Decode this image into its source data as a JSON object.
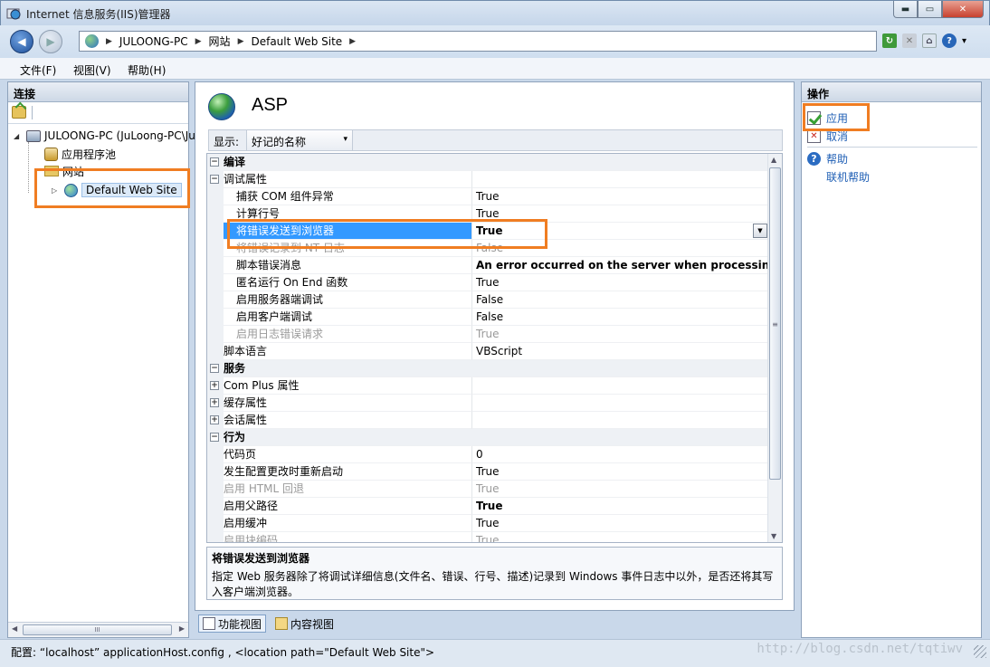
{
  "window": {
    "title": "Internet 信息服务(IIS)管理器",
    "buttons": {
      "minimize": "▬",
      "maximize": "▭",
      "close": "✕"
    }
  },
  "address_bar": {
    "segments": [
      "JULOONG-PC",
      "网站",
      "Default Web Site"
    ],
    "separator": "▶"
  },
  "nav": {
    "back": "◀",
    "forward": "▶"
  },
  "tool_icons": {
    "refresh": "↻",
    "stop": "✕",
    "home": "⌂",
    "help": "?",
    "help_arrow": "▾"
  },
  "menu": [
    "文件(F)",
    "视图(V)",
    "帮助(H)"
  ],
  "connections": {
    "header": "连接",
    "tree": {
      "server": "JULOONG-PC (JuLoong-PC\\JuLoong)",
      "app_pools": "应用程序池",
      "sites": "网站",
      "site": "Default Web Site"
    },
    "scroll_grip": "III"
  },
  "feature": {
    "title": "ASP",
    "display_label": "显示:",
    "display_value": "好记的名称",
    "dropdown_arrow": "▾"
  },
  "properties": {
    "rows": [
      {
        "type": "cat",
        "name": "编译",
        "value": "",
        "sign": "⊟"
      },
      {
        "type": "group",
        "name": "调试属性",
        "value": "",
        "sign": "⊟"
      },
      {
        "type": "sub",
        "name": "捕获 COM 组件异常",
        "value": "True"
      },
      {
        "type": "sub",
        "name": "计算行号",
        "value": "True"
      },
      {
        "type": "sub",
        "name": "将错误发送到浏览器",
        "value": "True",
        "selected": true,
        "bold": true
      },
      {
        "type": "sub",
        "name": "将错误记录到 NT 日志",
        "value": "False",
        "disabled": true
      },
      {
        "type": "sub",
        "name": "脚本错误消息",
        "value": "An error occurred on the server when processing the URL. Please contact the system administrator.",
        "bold": true
      },
      {
        "type": "sub",
        "name": "匿名运行 On End 函数",
        "value": "True"
      },
      {
        "type": "sub",
        "name": "启用服务器端调试",
        "value": "False"
      },
      {
        "type": "sub",
        "name": "启用客户端调试",
        "value": "False"
      },
      {
        "type": "sub",
        "name": "启用日志错误请求",
        "value": "True",
        "disabled": true
      },
      {
        "type": "plain",
        "name": "脚本语言",
        "value": "VBScript"
      },
      {
        "type": "cat",
        "name": "服务",
        "value": "",
        "sign": "⊟"
      },
      {
        "type": "group",
        "name": "Com Plus 属性",
        "value": "",
        "sign": "⊞"
      },
      {
        "type": "group",
        "name": "缓存属性",
        "value": "",
        "sign": "⊞"
      },
      {
        "type": "group",
        "name": "会话属性",
        "value": "",
        "sign": "⊞"
      },
      {
        "type": "cat",
        "name": "行为",
        "value": "",
        "sign": "⊟"
      },
      {
        "type": "plain",
        "name": "代码页",
        "value": "0"
      },
      {
        "type": "plain",
        "name": "发生配置更改时重新启动",
        "value": "True"
      },
      {
        "type": "plain",
        "name": "启用 HTML 回退",
        "value": "True",
        "disabled": true
      },
      {
        "type": "plain",
        "name": "启用父路径",
        "value": "True",
        "bold": true
      },
      {
        "type": "plain",
        "name": "启用缓冲",
        "value": "True"
      },
      {
        "type": "plain",
        "name": "启用块编码",
        "value": "True",
        "disabled": true
      }
    ],
    "dropdown_arrow": "▼",
    "scroll": {
      "up": "▲",
      "down": "▼",
      "grip": "≡"
    }
  },
  "description": {
    "title": "将错误发送到浏览器",
    "text": "指定 Web 服务器除了将调试详细信息(文件名、错误、行号、描述)记录到 Windows 事件日志中以外，是否还将其写入客户端浏览器。"
  },
  "view_tabs": [
    "功能视图",
    "内容视图"
  ],
  "actions": {
    "header": "操作",
    "apply": "应用",
    "cancel": "取消",
    "help": "帮助",
    "online_help": "联机帮助",
    "cancel_icon": "✕",
    "help_icon": "?"
  },
  "status": {
    "text": "配置: “localhost” applicationHost.config , <location path=\"Default Web Site\">",
    "watermark": "http://blog.csdn.net/tqtiwv"
  },
  "colors": {
    "highlight": "#f07d22",
    "selection": "#3399ff",
    "link": "#1f5fb5"
  }
}
